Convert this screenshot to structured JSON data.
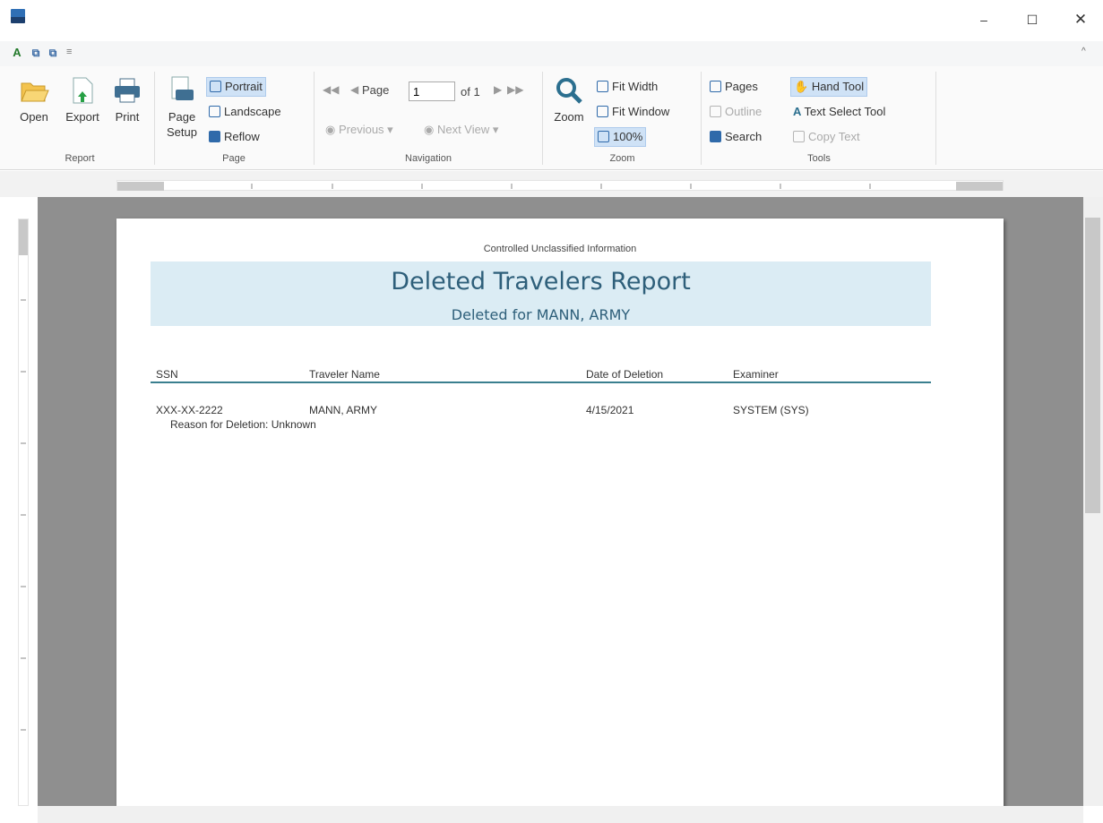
{
  "window": {
    "minimize": "–",
    "maximize": "☐",
    "close": "✕"
  },
  "quick_access": {
    "a": "A",
    "b": "⧉",
    "c": "⧉",
    "more": "≡"
  },
  "ribbon": {
    "collapse": "^",
    "report_group": {
      "label": "Report",
      "open": "Open",
      "export": "Export",
      "print": "Print"
    },
    "page_group": {
      "label": "Page",
      "page_setup_line1": "Page",
      "page_setup_line2": "Setup",
      "portrait": "Portrait",
      "landscape": "Landscape",
      "reflow": "Reflow"
    },
    "navigation_group": {
      "label": "Navigation",
      "page_label": "Page",
      "page_value": "1",
      "of_pages": "of 1",
      "previous_view": "Previous",
      "next_view": "Next View"
    },
    "zoom_group": {
      "label": "Zoom",
      "zoom": "Zoom",
      "fit_width": "Fit Width",
      "fit_window": "Fit Window",
      "zoom_100": "100%"
    },
    "tools_group": {
      "label": "Tools",
      "pages": "Pages",
      "outline": "Outline",
      "search": "Search",
      "hand_tool": "Hand Tool",
      "text_select_tool": "Text Select Tool",
      "copy_text": "Copy Text"
    }
  },
  "report": {
    "classification": "Controlled Unclassified Information",
    "title": "Deleted Travelers Report",
    "subtitle": "Deleted for MANN, ARMY",
    "columns": [
      "SSN",
      "Traveler Name",
      "Date of Deletion",
      "Examiner"
    ],
    "rows": [
      {
        "ssn": "XXX-XX-2222",
        "traveler_name": "MANN, ARMY",
        "date_of_deletion": "4/15/2021",
        "examiner": "SYSTEM (SYS)",
        "reason": "Reason for Deletion: Unknown"
      }
    ]
  }
}
